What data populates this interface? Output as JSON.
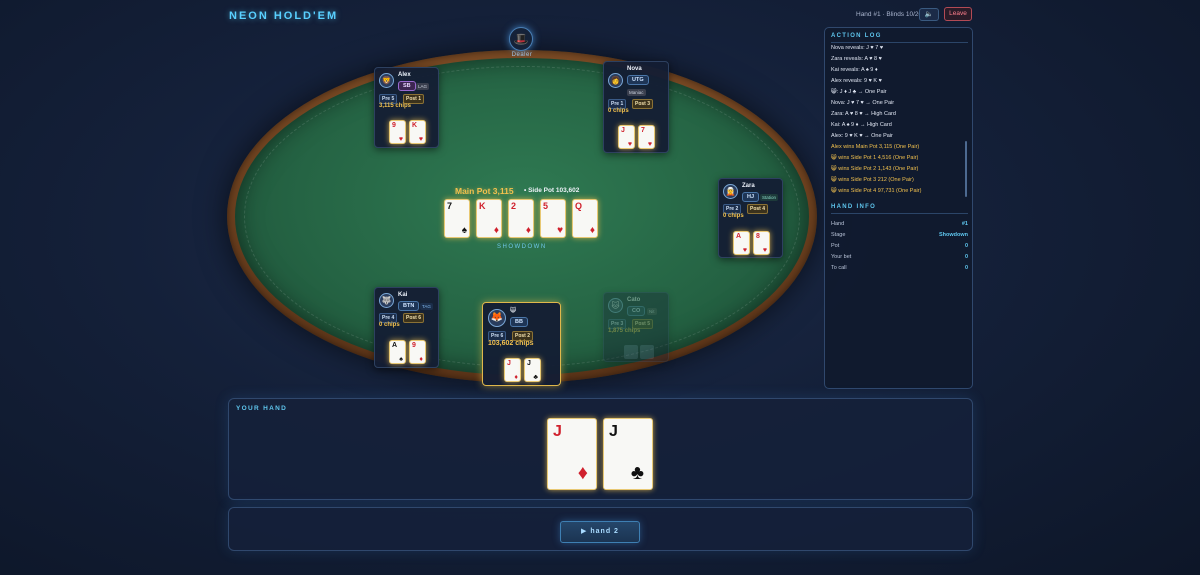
{
  "header": {
    "title": "NEON HOLD'EM",
    "hand_blinds": "Hand #1 · Blinds 10/20",
    "sound_icon": "🔈",
    "leave_label": "Leave"
  },
  "table": {
    "dealer_icon": "🎩",
    "dealer_label": "Dealer",
    "main_pot": "Main Pot 3,115",
    "side_pot": "• Side Pot 103,602",
    "stage_label": "SHOWDOWN",
    "board": [
      {
        "rank": "7",
        "suit": "♠",
        "red": false
      },
      {
        "rank": "K",
        "suit": "♦",
        "red": true
      },
      {
        "rank": "2",
        "suit": "♦",
        "red": true
      },
      {
        "rank": "5",
        "suit": "♥",
        "red": true
      },
      {
        "rank": "Q",
        "suit": "♦",
        "red": true
      }
    ]
  },
  "players": {
    "alex": {
      "avatar": "🦁",
      "name": "Alex",
      "position": "SB",
      "style": "LAG",
      "pre": "Pre 5",
      "post": "Post 1",
      "chips": "3,115 chips",
      "cards": [
        {
          "rank": "9",
          "suit": "♥"
        },
        {
          "rank": "K",
          "suit": "♥"
        }
      ]
    },
    "nova": {
      "avatar": "👩",
      "name": "Nova",
      "position": "UTG",
      "style": "Maniac",
      "pre": "Pre 1",
      "post": "Post 3",
      "chips": "0 chips",
      "cards": [
        {
          "rank": "J",
          "suit": "♥"
        },
        {
          "rank": "7",
          "suit": "♥"
        }
      ]
    },
    "zara": {
      "avatar": "🧝",
      "name": "Zara",
      "position": "HJ",
      "style": "Station",
      "pre": "Pre 2",
      "post": "Post 4",
      "chips": "0 chips",
      "cards": [
        {
          "rank": "A",
          "suit": "♥"
        },
        {
          "rank": "8",
          "suit": "♥"
        }
      ]
    },
    "kai": {
      "avatar": "🐺",
      "name": "Kai",
      "position": "BTN",
      "style": "TAG",
      "pre": "Pre 4",
      "post": "Post 6",
      "chips": "0 chips",
      "cards": [
        {
          "rank": "A",
          "suit": "♠",
          "red": false
        },
        {
          "rank": "9",
          "suit": "♦",
          "red": true
        }
      ]
    },
    "me": {
      "avatar": "🦊",
      "name": "😸",
      "position": "BB",
      "pre": "Pre 6",
      "post": "Post 2",
      "chips": "103,602 chips",
      "cards": [
        {
          "rank": "J",
          "suit": "♦",
          "red": true
        },
        {
          "rank": "J",
          "suit": "♣",
          "red": false
        }
      ]
    },
    "cato": {
      "avatar": "🐱",
      "name": "Cato",
      "position": "CO",
      "style": "Nit",
      "pre": "Pre 3",
      "post": "Post 5",
      "chips": "1,875 chips"
    }
  },
  "panel": {
    "log_title": "ACTION LOG",
    "log": [
      "Nova reveals: J ♥ 7 ♥",
      "Zara reveals: A ♥ 8 ♥",
      "Kai reveals: A ♠ 9 ♦",
      "Alex reveals: 9 ♥ K ♥",
      "😸: J ♦ J ♣ → One Pair",
      "Nova: J ♥ 7 ♥ → One Pair",
      "Zara: A ♥ 8 ♥ → High Card",
      "Kai: A ♠ 9 ♦ → High Card",
      "Alex: 9 ♥ K ♥ → One Pair",
      "Alex wins Main Pot 3,115 (One Pair)",
      "😸 wins Side Pot 1 4,516 (One Pair)",
      "😸 wins Side Pot 2 1,143 (One Pair)",
      "😸 wins Side Pot 3 212 (One Pair)",
      "😸 wins Side Pot 4 97,731 (One Pair)"
    ],
    "info_title": "HAND INFO",
    "info": [
      {
        "label": "Hand",
        "value": "#1"
      },
      {
        "label": "Stage",
        "value": "Showdown"
      },
      {
        "label": "Pot",
        "value": "0"
      },
      {
        "label": "Your bet",
        "value": "0"
      },
      {
        "label": "To call",
        "value": "0"
      }
    ]
  },
  "your_hand": {
    "label": "YOUR HAND",
    "cards": [
      {
        "rank": "J",
        "suit": "♦",
        "red": true
      },
      {
        "rank": "J",
        "suit": "♣",
        "red": false
      }
    ]
  },
  "actions": {
    "next_label": "▶ hand 2"
  },
  "colors": {
    "accent": "#59d0ff",
    "gold": "#f2c14e",
    "felt": "#256444",
    "rail": "#6b3f1f"
  }
}
